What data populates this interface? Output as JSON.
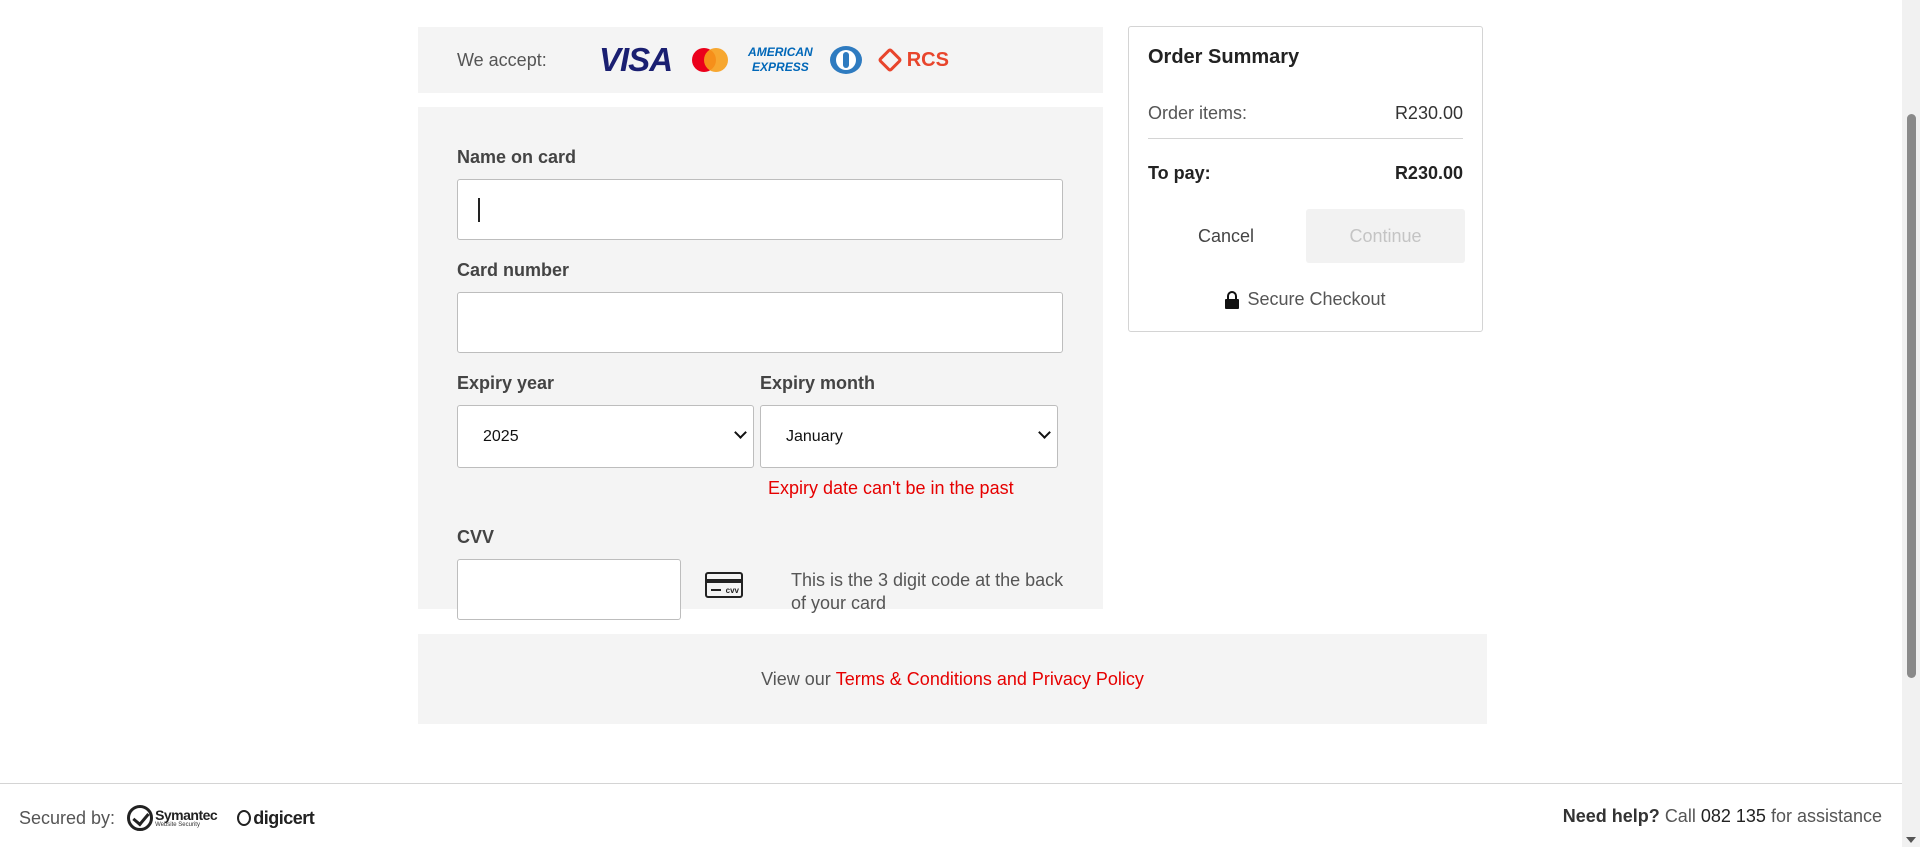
{
  "payment": {
    "accept_label": "We accept:",
    "logos": {
      "visa": "VISA",
      "amex_line1": "AMERICAN",
      "amex_line2": "EXPRESS",
      "rcs": "RCS"
    },
    "fields": {
      "name_label": "Name on card",
      "name_value": "",
      "card_label": "Card number",
      "card_value": "",
      "expiry_year_label": "Expiry year",
      "expiry_year_value": "2025",
      "expiry_month_label": "Expiry month",
      "expiry_month_value": "January",
      "expiry_error": "Expiry date can't be in the past",
      "cvv_label": "CVV",
      "cvv_value": "",
      "cvv_icon_text": "cvv",
      "cvv_hint": "This is the 3 digit code at the back of your card"
    },
    "terms_prefix": "View our",
    "terms_link": "Terms & Conditions and Privacy Policy"
  },
  "summary": {
    "title": "Order Summary",
    "items_label": "Order items:",
    "items_value": "R230.00",
    "topay_label": "To pay:",
    "topay_value": "R230.00",
    "cancel_label": "Cancel",
    "continue_label": "Continue",
    "secure_label": "Secure Checkout"
  },
  "footer": {
    "secured_by": "Secured by:",
    "symantec": "Symantec",
    "symantec_sub": "Website Security",
    "digicert": "digicert",
    "help_bold": "Need help?",
    "help_call": "Call",
    "help_number": "082 135",
    "help_suffix": "for assistance"
  },
  "colors": {
    "accent_red": "#e60000",
    "panel_bg": "#f4f4f4",
    "visa_blue": "#1a1f71",
    "amex_blue": "#0067b8",
    "rcs_orange": "#e8452c"
  }
}
